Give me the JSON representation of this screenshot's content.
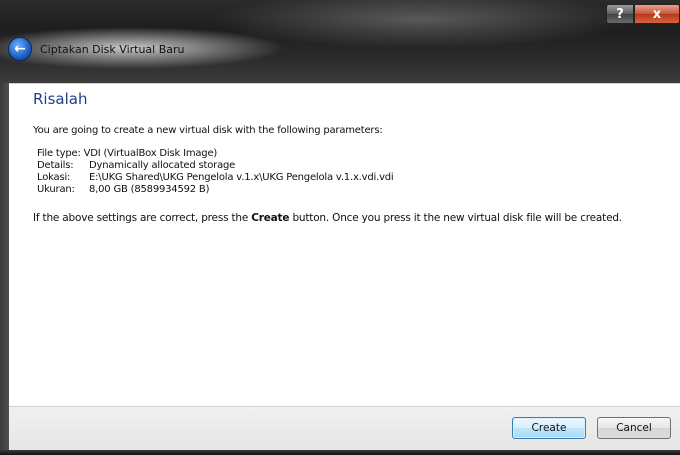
{
  "window": {
    "title": "Ciptakan Disk Virtual Baru",
    "caption_buttons": {
      "help_label": "?",
      "close_label": "x"
    },
    "back_icon": "back-arrow-icon"
  },
  "page": {
    "heading": "Risalah",
    "intro": "You are going to create a new virtual disk with the following parameters:",
    "params": [
      {
        "label": "File type:",
        "value": "VDI (VirtualBox Disk Image)"
      },
      {
        "label": "Details:",
        "value": "Dynamically allocated storage"
      },
      {
        "label": "Lokasi:",
        "value": "E:\\UKG Shared\\UKG Pengelola v.1.x\\UKG Pengelola v.1.x.vdi.vdi"
      },
      {
        "label": "Ukuran:",
        "value": "8,00 GB (8589934592 B)"
      }
    ],
    "note_before": "If the above settings are correct, press the ",
    "note_bold": "Create",
    "note_after": " button. Once you press it the new virtual disk file will be created."
  },
  "footer": {
    "create_label": "Create",
    "cancel_label": "Cancel"
  },
  "colors": {
    "heading": "#1e3f8a",
    "close_button": "#c8553a",
    "default_button_border": "#3c7fb1"
  }
}
